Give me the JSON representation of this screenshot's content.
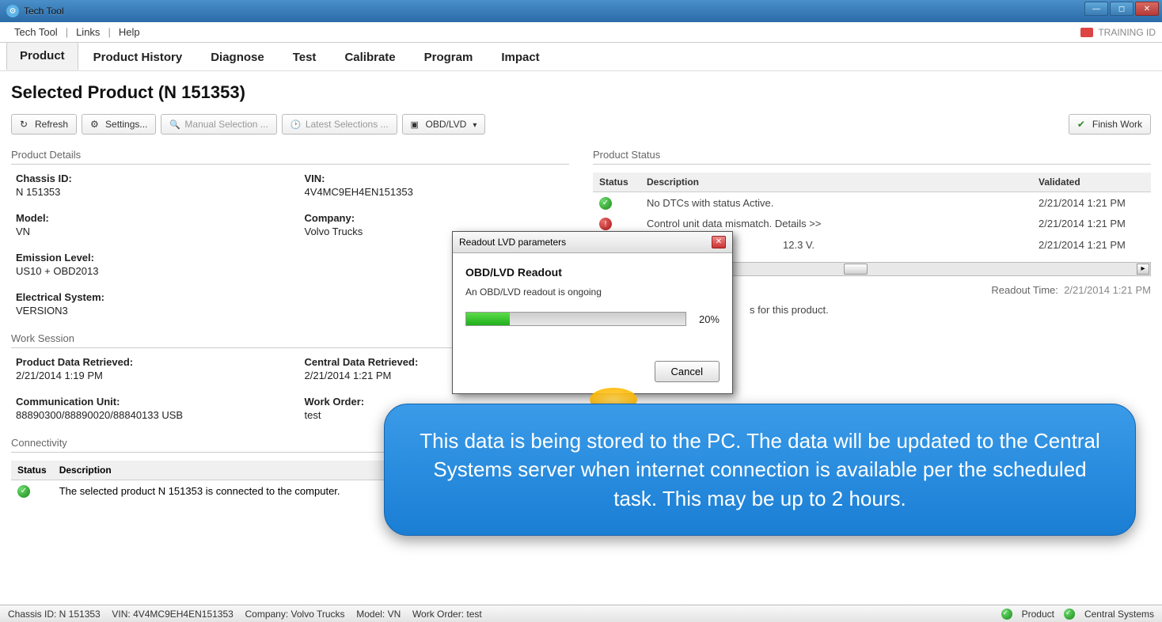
{
  "window": {
    "title": "Tech Tool"
  },
  "menubar": {
    "items": [
      "Tech Tool",
      "Links",
      "Help"
    ],
    "training": "TRAINING ID"
  },
  "navtabs": [
    "Product",
    "Product History",
    "Diagnose",
    "Test",
    "Calibrate",
    "Program",
    "Impact"
  ],
  "page": {
    "title": "Selected Product (N 151353)"
  },
  "toolbar": {
    "refresh": "Refresh",
    "settings": "Settings...",
    "manual": "Manual Selection ...",
    "latest": "Latest Selections ...",
    "obd": "OBD/LVD",
    "finish": "Finish Work"
  },
  "sections": {
    "product_details": "Product Details",
    "product_status": "Product Status",
    "work_session": "Work Session",
    "connectivity": "Connectivity"
  },
  "details": {
    "chassis_id_label": "Chassis ID:",
    "chassis_id": "N 151353",
    "vin_label": "VIN:",
    "vin": "4V4MC9EH4EN151353",
    "model_label": "Model:",
    "model": "VN",
    "company_label": "Company:",
    "company": "Volvo Trucks",
    "emission_label": "Emission Level:",
    "emission": "US10 + OBD2013",
    "electrical_label": "Electrical System:",
    "electrical": "VERSION3"
  },
  "status_headers": {
    "status": "Status",
    "description": "Description",
    "validated": "Validated"
  },
  "status_rows": [
    {
      "icon": "green",
      "desc": "No DTCs with status Active.",
      "validated": "2/21/2014 1:21 PM"
    },
    {
      "icon": "red",
      "desc": "Control unit data mismatch. Details >>",
      "validated": "2/21/2014 1:21 PM"
    },
    {
      "icon": "blue",
      "desc": "12.3 V.",
      "validated": "2/21/2014 1:21 PM"
    }
  ],
  "readout_time": {
    "label": "Readout Time:",
    "value": "2/21/2014 1:21 PM"
  },
  "campaign_msg": "s for this product.",
  "work": {
    "pdr_label": "Product Data Retrieved:",
    "pdr": "2/21/2014 1:19 PM",
    "cdr_label": "Central Data Retrieved:",
    "cdr": "2/21/2014 1:21 PM",
    "cu_label": "Communication Unit:",
    "cu": "88890300/88890020/88840133 USB",
    "wo_label": "Work Order:",
    "wo": "test"
  },
  "conn_headers": {
    "status": "Status",
    "description": "Description"
  },
  "conn_rows": [
    {
      "icon": "green",
      "desc": "The selected product N 151353 is connected to the computer."
    }
  ],
  "dialog": {
    "title": "Readout LVD parameters",
    "heading": "OBD/LVD Readout",
    "message": "An OBD/LVD readout is ongoing",
    "percent": "20%",
    "cancel": "Cancel"
  },
  "callout": "This data is being stored to the PC.  The data will be updated to the Central Systems server when internet connection is available per the scheduled task.   This may be up to 2 hours.",
  "statusbar": {
    "chassis": "Chassis ID: N 151353",
    "vin": "VIN: 4V4MC9EH4EN151353",
    "company": "Company: Volvo Trucks",
    "model": "Model: VN",
    "work_order": "Work Order: test",
    "product": "Product",
    "central": "Central Systems"
  }
}
